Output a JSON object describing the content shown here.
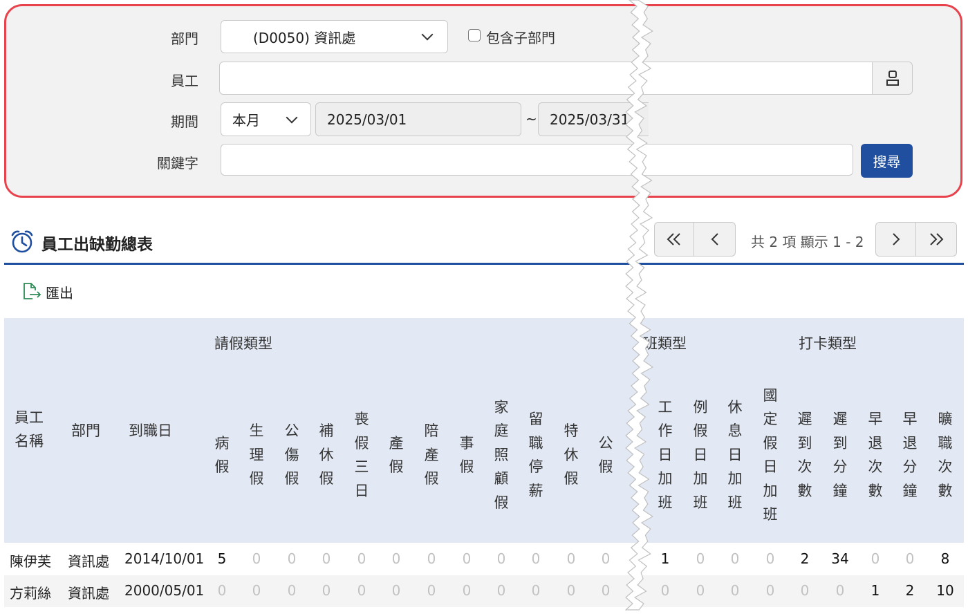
{
  "search": {
    "department_label": "部門",
    "department_value": "(D0050) 資訊處",
    "include_sub_label": "包含子部門",
    "employee_label": "員工",
    "employee_value": "",
    "period_label": "期間",
    "period_value": "本月",
    "date_from": "2025/03/01",
    "date_sep": "~",
    "date_to": "2025/03/31",
    "keyword_label": "關鍵字",
    "keyword_value": "",
    "search_button": "搜尋"
  },
  "report": {
    "title": "員工出缺勤總表",
    "export_label": "匯出",
    "pagination": {
      "info": "共 2 項 顯示 1 - 2"
    }
  },
  "table": {
    "groups": {
      "leave": "請假類型",
      "overtime": "班類型",
      "punch": "打卡類型"
    },
    "headers": {
      "name": "員工名稱",
      "dept": "部門",
      "hire": "到職日",
      "metrics": [
        "病假",
        "生理假",
        "公傷假",
        "補休假",
        "喪假三日",
        "產假",
        "陪產假",
        "事假",
        "家庭照顧假",
        "留職停薪",
        "特休假",
        "公假",
        "工作日加班",
        "例假日加班",
        "休息日加班",
        "國定假日加班",
        "遲到次數",
        "遲到分鐘",
        "早退次數",
        "早退分鐘",
        "曠職次數"
      ]
    },
    "rows": [
      {
        "name": "陳伊芙",
        "dept": "資訊處",
        "hire": "2014/10/01",
        "values": [
          "5",
          "0",
          "0",
          "0",
          "0",
          "0",
          "0",
          "0",
          "0",
          "0",
          "0",
          "0",
          "1",
          "0",
          "0",
          "0",
          "2",
          "34",
          "0",
          "0",
          "8"
        ]
      },
      {
        "name": "方莉絲",
        "dept": "資訊處",
        "hire": "2000/05/01",
        "values": [
          "0",
          "0",
          "0",
          "0",
          "0",
          "0",
          "0",
          "0",
          "0",
          "0",
          "0",
          "0",
          "0",
          "0",
          "0",
          "0",
          "0",
          "0",
          "1",
          "2",
          "10"
        ]
      }
    ]
  },
  "icons": {
    "employee_picker": "person-icon",
    "title": "alarm-clock-icon",
    "export": "export-file-icon"
  },
  "colors": {
    "panel_border": "#e8434d",
    "primary": "#1f4f9e",
    "header_bg": "#e3e9f4"
  }
}
